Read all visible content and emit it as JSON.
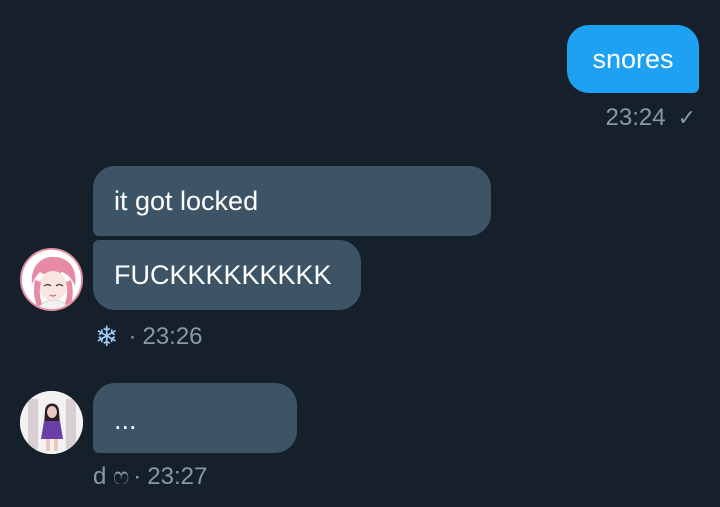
{
  "messages": {
    "outgoing": {
      "text": "snores",
      "time": "23:24",
      "status_icon": "check-icon"
    },
    "incoming_1": {
      "lines": [
        "it got locked",
        "FUCKKKKKKKKK"
      ],
      "sender_icon": "snowflake-icon",
      "sender_glyph": "❄",
      "separator": "·",
      "time": "23:26"
    },
    "incoming_2": {
      "text": "...",
      "sender": "d ෆ",
      "separator": "·",
      "time": "23:27"
    }
  },
  "colors": {
    "background": "#15202b",
    "outgoing_bubble": "#1da1f2",
    "incoming_bubble": "#3d5466",
    "meta_text": "#8899a6"
  }
}
